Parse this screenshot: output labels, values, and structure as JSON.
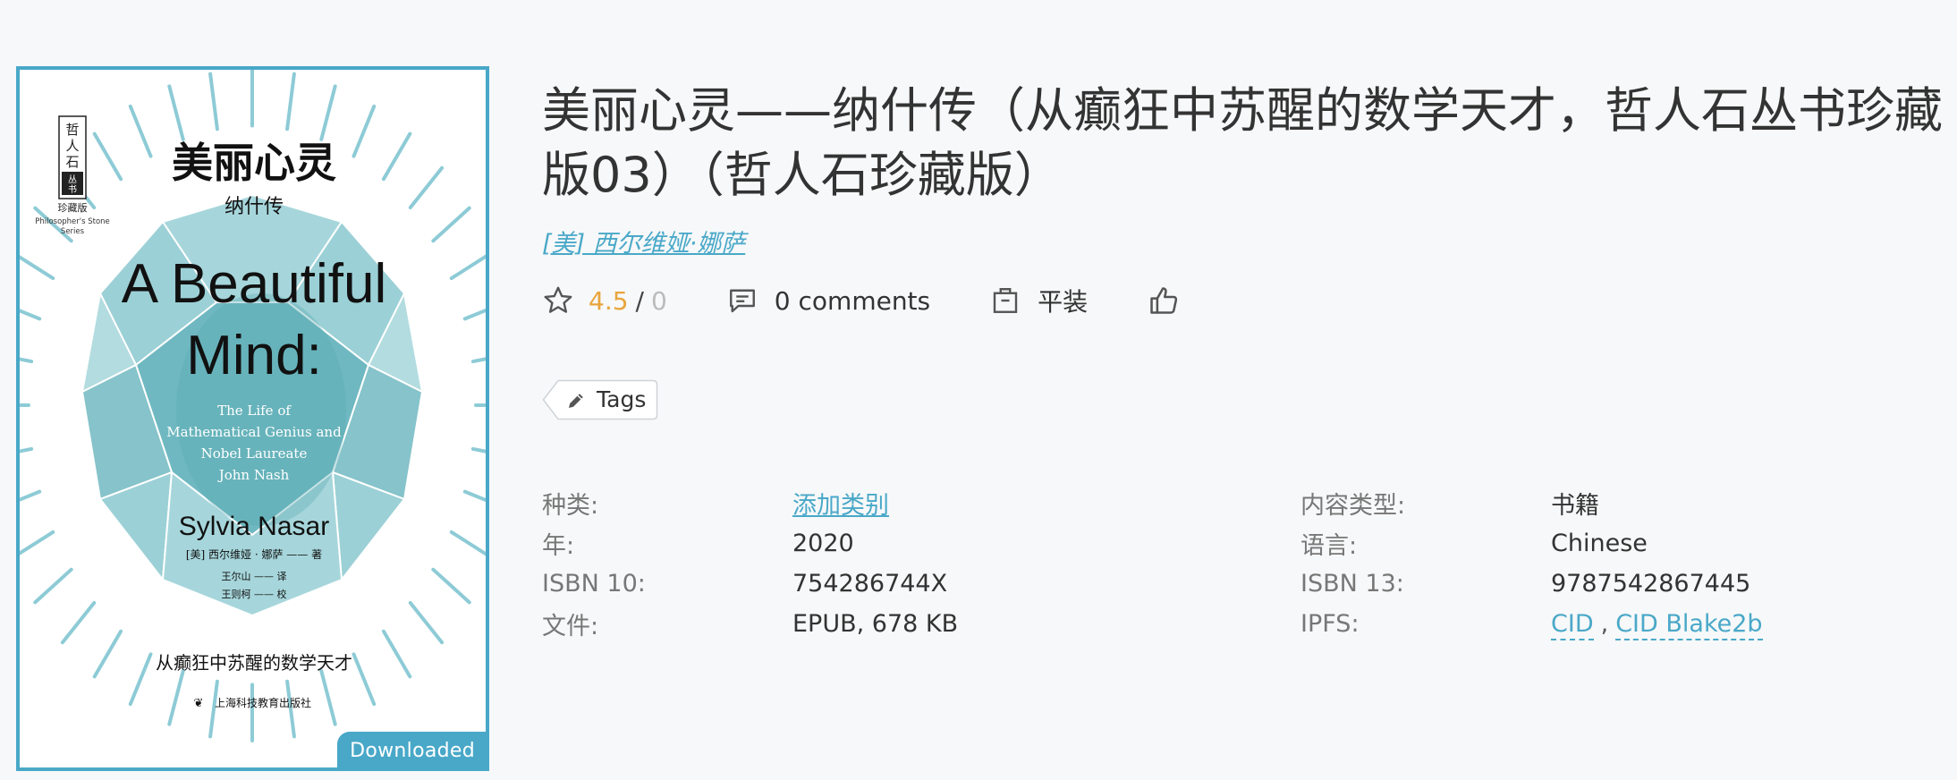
{
  "cover": {
    "badge": "Downloaded",
    "series_logo_chars": [
      "哲",
      "人",
      "石",
      "丛",
      "书"
    ],
    "series_edition": "珍藏版",
    "series_name_en_1": "Philosopher's Stone",
    "series_name_en_2": "Series",
    "title_cn": "美丽心灵",
    "subtitle_cn": "纳什传",
    "title_en_1": "A Beautiful",
    "title_en_2": "Mind:",
    "desc_en_1": "The Life of",
    "desc_en_2": "Mathematical Genius and",
    "desc_en_3": "Nobel Laureate",
    "desc_en_4": "John Nash",
    "author_en": "Sylvia Nasar",
    "author_cn": "[美] 西尔维娅 · 娜萨 —— 著",
    "translator": "王尔山 —— 译",
    "editor": "王则柯 —— 校",
    "tagline_cn": "从癫狂中苏醒的数学天才",
    "publisher": "上海科技教育出版社",
    "accent_color": "#49a8c8",
    "gem_color": "#7fc4cc"
  },
  "book": {
    "title": "美丽心灵——纳什传（从癫狂中苏醒的数学天才，哲人石丛书珍藏版03）（哲人石珍藏版）",
    "author": "[美] 西尔维娅·娜萨"
  },
  "stats": {
    "rating_value": "4.5",
    "rating_separator": "/",
    "rating_max": "0",
    "comments_label": "0 comments",
    "binding_label": "平装",
    "rating_color": "#e9a53c"
  },
  "tags": {
    "label": "Tags"
  },
  "meta": {
    "left": [
      {
        "key": "种类:",
        "value": "添加类别",
        "link": true
      },
      {
        "key": "年:",
        "value": "2020"
      },
      {
        "key": "ISBN 10:",
        "value": "754286744X"
      },
      {
        "key": "文件:",
        "value": "EPUB, 678 KB"
      }
    ],
    "right": [
      {
        "key": "内容类型:",
        "value": "书籍"
      },
      {
        "key": "语言:",
        "value": "Chinese"
      },
      {
        "key": "ISBN 13:",
        "value": "9787542867445"
      },
      {
        "key": "IPFS:",
        "cid": "CID",
        "comma": ",",
        "cid_blake": "CID Blake2b"
      }
    ]
  },
  "icons": {
    "rating": "star-icon",
    "comments": "comment-icon",
    "binding": "book-binding-icon",
    "like": "thumbs-up-icon",
    "tags": "pencil-icon"
  }
}
